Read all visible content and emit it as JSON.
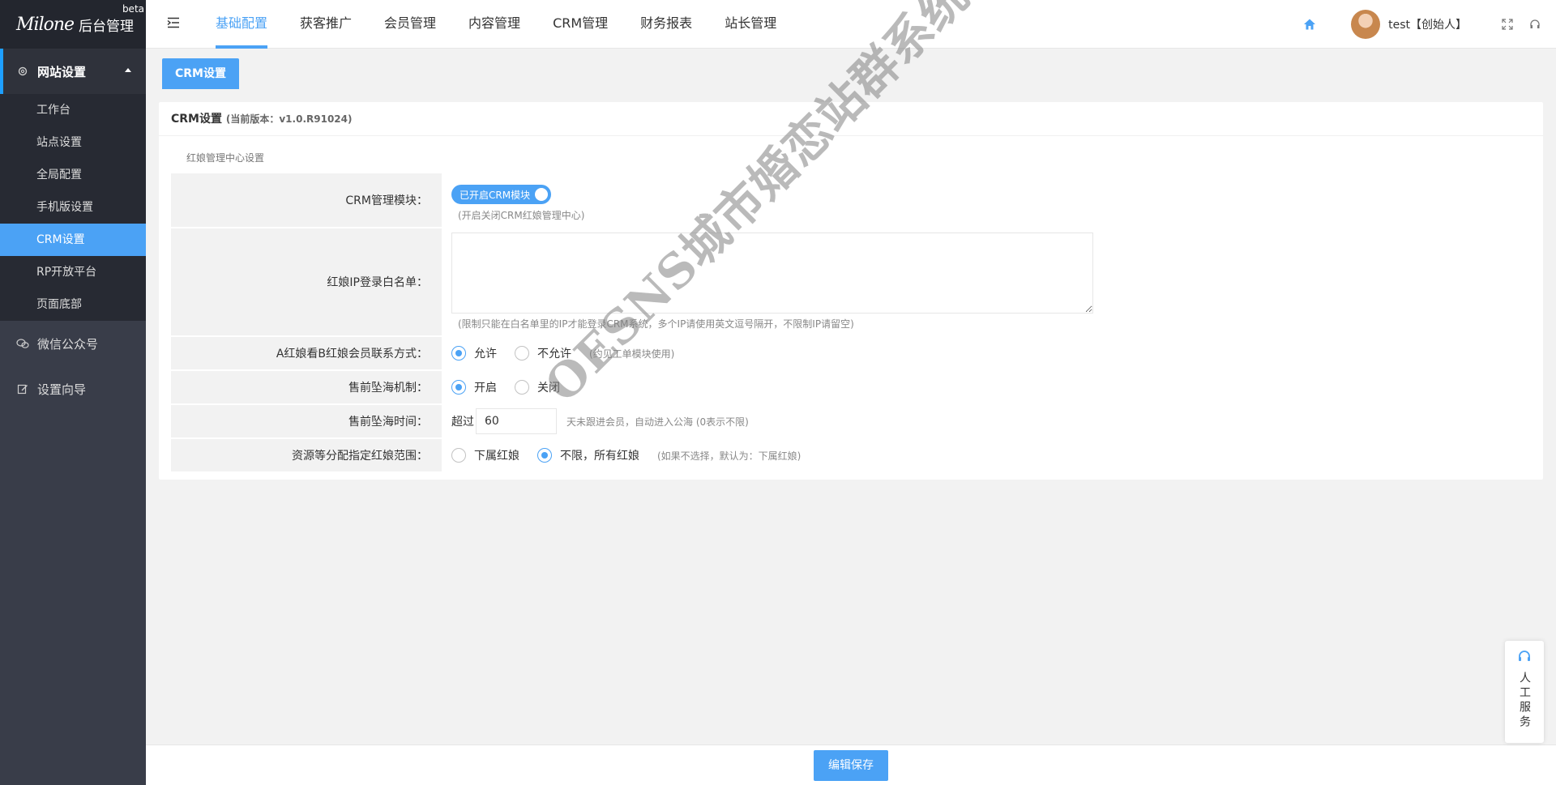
{
  "brand": {
    "logo_mark": "Milone",
    "title": "后台管理",
    "badge": "beta"
  },
  "sidebar": {
    "group_main": {
      "label": "网站设置",
      "icon": "gear-icon"
    },
    "items": [
      {
        "label": "工作台"
      },
      {
        "label": "站点设置"
      },
      {
        "label": "全局配置"
      },
      {
        "label": "手机版设置"
      },
      {
        "label": "CRM设置",
        "active": true
      },
      {
        "label": "RP开放平台"
      },
      {
        "label": "页面底部"
      }
    ],
    "group_wechat": {
      "label": "微信公众号",
      "icon": "wechat-icon"
    },
    "group_guide": {
      "label": "设置向导",
      "icon": "edit-icon"
    }
  },
  "header": {
    "nav": [
      "基础配置",
      "获客推广",
      "会员管理",
      "内容管理",
      "CRM管理",
      "财务报表",
      "站长管理"
    ],
    "active_nav": "基础配置",
    "user": "test【创始人】"
  },
  "tab": {
    "label": "CRM设置"
  },
  "card": {
    "title": "CRM设置",
    "version": "(当前版本：v1.0.R91024)",
    "section": "红娘管理中心设置",
    "crm_module": {
      "label": "CRM管理模块：",
      "switch_text": "已开启CRM模块",
      "hint": "(开启关闭CRM红娘管理中心)"
    },
    "ip_whitelist": {
      "label": "红娘IP登录白名单：",
      "value": "",
      "hint": "(限制只能在白名单里的IP才能登录CRM系统，多个IP请使用英文逗号隔开，不限制IP请留空)"
    },
    "contact_view": {
      "label": "A红娘看B红娘会员联系方式：",
      "opt_allow": "允许",
      "opt_deny": "不允许",
      "hint": "(约见工单模块使用)"
    },
    "presale_mech": {
      "label": "售前坠海机制：",
      "opt_on": "开启",
      "opt_off": "关闭"
    },
    "presale_time": {
      "label": "售前坠海时间：",
      "prefix": "超过",
      "value": "60",
      "hint": "天未跟进会员，自动进入公海 (0表示不限)"
    },
    "resource_scope": {
      "label": "资源等分配指定红娘范围：",
      "opt_sub": "下属红娘",
      "opt_all": "不限，所有红娘",
      "hint": "(如果不选择，默认为：下属红娘)"
    }
  },
  "watermark": "OESNS城市婚恋站群系统",
  "footer": {
    "save_label": "编辑保存"
  },
  "service": {
    "label": "人工服务"
  },
  "colors": {
    "accent": "#4BA2F5",
    "sidebar": "#393D49",
    "sidebar_dark": "#23262E"
  }
}
